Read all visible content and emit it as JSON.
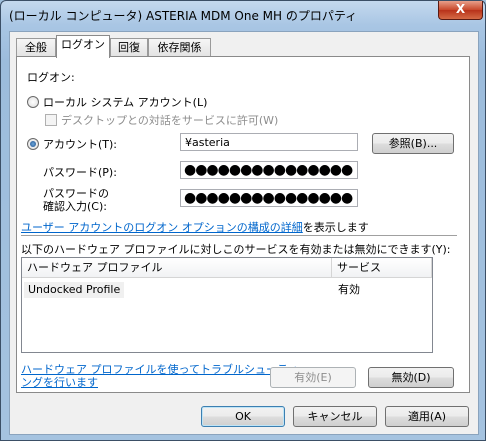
{
  "window": {
    "title": "(ローカル コンピュータ) ASTERIA MDM One MH のプロパティ",
    "close_glyph": "X"
  },
  "tabs": [
    {
      "label": "全般"
    },
    {
      "label": "ログオン"
    },
    {
      "label": "回復"
    },
    {
      "label": "依存関係"
    }
  ],
  "logon": {
    "heading": "ログオン:",
    "local_system_label": "ローカル システム アカウント(L)",
    "desktop_interact_label": "デスクトップとの対話をサービスに許可(W)",
    "this_account_label": "アカウント(T):",
    "account_value": "¥asteria",
    "browse_label": "参照(B)...",
    "password_label": "パスワード(P):",
    "password_value": "●●●●●●●●●●●●●●●",
    "confirm_label_1": "パスワードの",
    "confirm_label_2": "確認入力(C):",
    "confirm_value": "●●●●●●●●●●●●●●●",
    "help_link": "ユーザー アカウントのログオン オプションの構成の詳細",
    "help_suffix": "を表示します",
    "profile_text": "以下のハードウェア プロファイルに対しこのサービスを有効または無効にできます(Y):"
  },
  "profiles": {
    "columns": [
      "ハードウェア プロファイル",
      "サービス"
    ],
    "rows": [
      {
        "profile": "Undocked Profile",
        "service": "有効"
      }
    ]
  },
  "troubleshoot_link_1": "ハードウェア プロファイルを使ってトラブルシューティ",
  "troubleshoot_link_2": "ングを行います",
  "buttons": {
    "enable": "有効(E)",
    "disable": "無効(D)",
    "ok": "OK",
    "cancel": "キャンセル",
    "apply": "適用(A)"
  }
}
